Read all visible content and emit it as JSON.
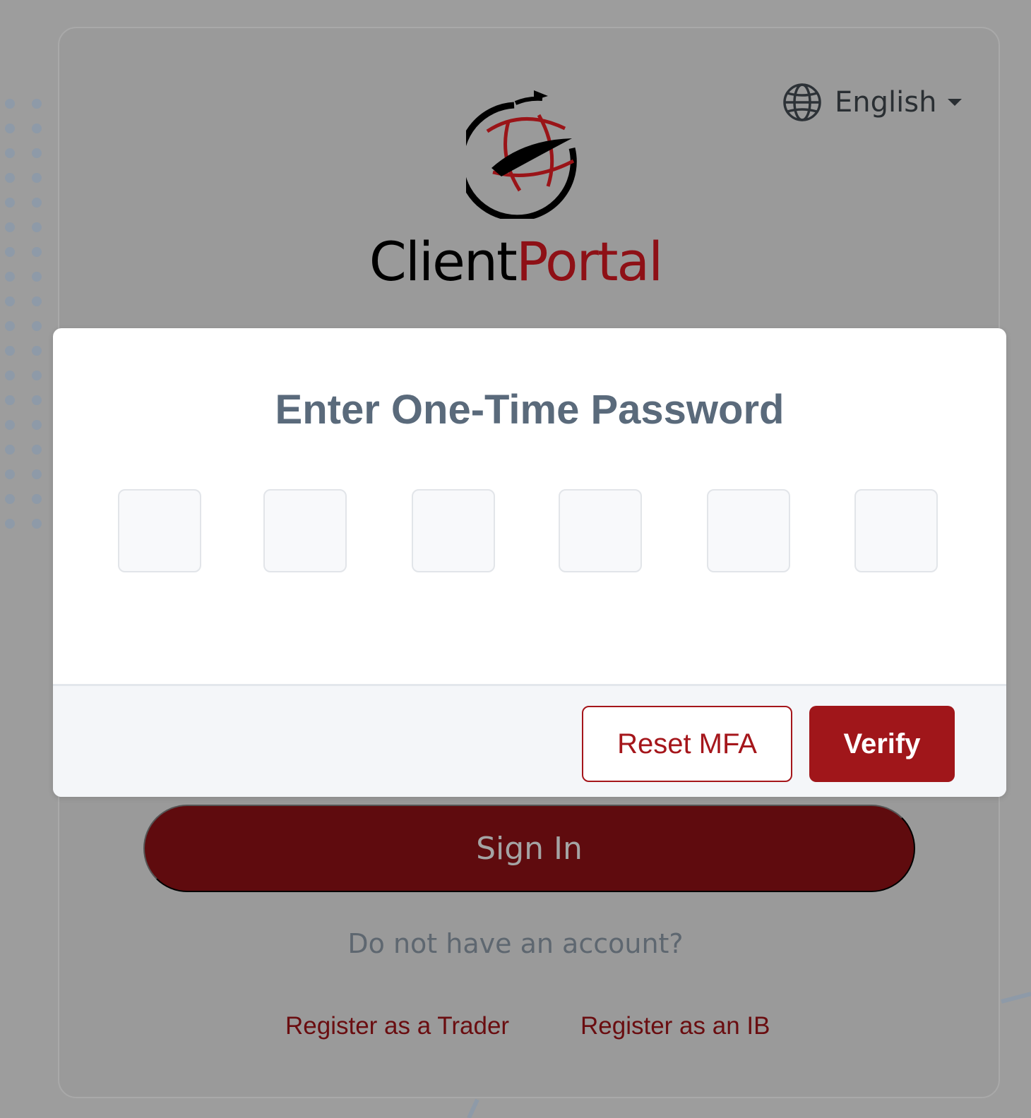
{
  "language": {
    "label": "English",
    "icon": "globe-icon"
  },
  "brand": {
    "part1": "Client",
    "part2": "Portal",
    "colors": {
      "dark": "#000000",
      "accent": "#8e1016"
    }
  },
  "otp_dialog": {
    "title": "Enter One-Time Password",
    "digits": [
      "",
      "",
      "",
      "",
      "",
      ""
    ],
    "reset_label": "Reset MFA",
    "verify_label": "Verify"
  },
  "login": {
    "sign_in_label": "Sign In",
    "no_account_text": "Do not have an account?",
    "register_trader_label": "Register as a Trader",
    "register_ib_label": "Register as an IB"
  },
  "colors": {
    "accent": "#a0161a",
    "backdrop": "#9d9d9d",
    "title": "#5a6a7b"
  }
}
